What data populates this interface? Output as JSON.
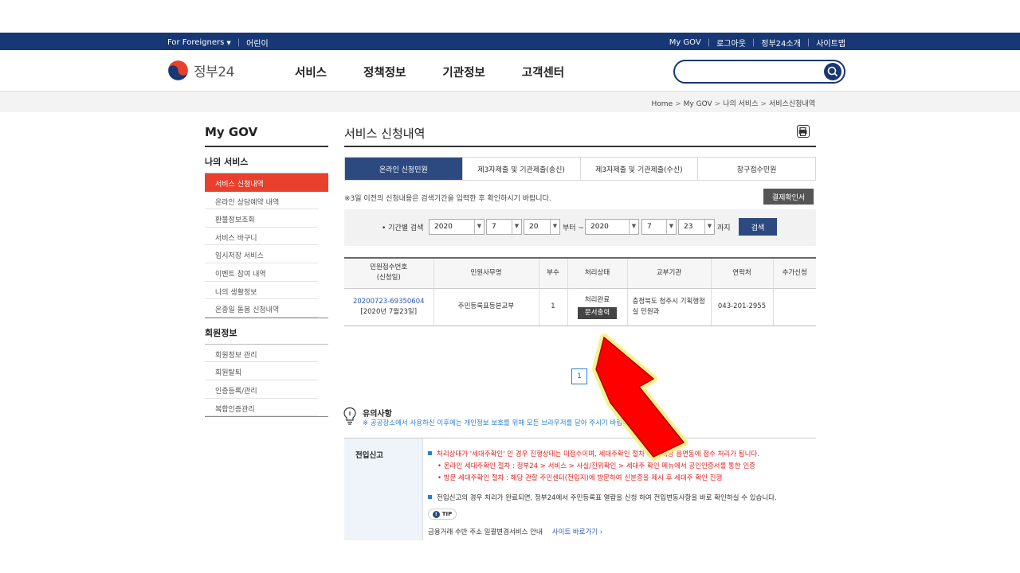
{
  "topbar": {
    "for_foreigners": "For Foreigners",
    "kids": "어린이",
    "my_gov": "My GOV",
    "logout": "로그아웃",
    "about": "정부24소개",
    "sitemap": "사이트맵"
  },
  "header": {
    "logo_text": "정부24",
    "nav": [
      "서비스",
      "정책정보",
      "기관정보",
      "고객센터"
    ],
    "search_value": ""
  },
  "breadcrumb": [
    "Home",
    "My GOV",
    "나의 서비스",
    "서비스신청내역"
  ],
  "sidebar": {
    "title": "My GOV",
    "group1": "나의 서비스",
    "items1": [
      "서비스 신청내역",
      "온라인 상담예약 내역",
      "환불정보조회",
      "서비스 바구니",
      "임시저장 서비스",
      "이벤트 참여 내역",
      "나의 생활정보",
      "온종일 돌봄 신청내역"
    ],
    "group2": "회원정보",
    "items2": [
      "회원정보 관리",
      "회원탈퇴",
      "인증등록/관리",
      "복합인증관리"
    ]
  },
  "main": {
    "title": "서비스 신청내역",
    "tabs": [
      "온라인 신청민원",
      "제3자제출 및 기관제출(송신)",
      "제3자제출 및 기관제출(수신)",
      "창구접수민원"
    ],
    "notice": "※3일 이전의 신청내용은 검색기간을 입력한 후 확인하시기 바랍니다.",
    "cert_button": "결제확인서",
    "period": {
      "label": "• 기간별 검색",
      "from_year": "2020",
      "from_month": "7",
      "from_day": "20",
      "from_suffix": "부터 ~",
      "to_year": "2020",
      "to_month": "7",
      "to_day": "23",
      "to_suffix": "까지",
      "search_button": "검색"
    },
    "table": {
      "headers": [
        "민원접수번호",
        "(신청일)",
        "민원사무명",
        "부수",
        "처리상태",
        "교부기관",
        "연락처",
        "추가신청"
      ],
      "row": {
        "receipt_no": "20200723-69350604",
        "date": "[2020년 7월23일]",
        "service": "주민등록표등본교부",
        "copies": "1",
        "status": "처리완료",
        "print_button": "문서출력",
        "agency_line1": "충청북도 청주시 기획행정",
        "agency_line2": "실 민원과",
        "phone": "043-201-2955",
        "extra": ""
      }
    },
    "pager": "1"
  },
  "caution": {
    "title": "유의사항",
    "subtitle": "※ 공공장소에서 사용하신 이후에는 개인정보 보호를 위해 모든 브라우저를 닫아 주시기 바랍니다.",
    "section_label": "전입신고",
    "line1": "처리상태가 '세대주확인' 인 경우 진행상태는 미접수이며, 세대주확인 절차 이후 해당 읍면동에 접수 처리가 됩니다.",
    "line2": "• 온라인 세대주확인 절차 : 정부24 > 서비스 > 사실/진위확인 > 세대주 확인 메뉴에서 공인인증서를 통한 인증",
    "line3": "• 방문 세대주확인 절차 : 해당 관할 주민센터(전입지)에 방문하여 신분증을 제시 후 세대주 확인 진행",
    "line4": "전입신고의 경우 처리가 완료되면, 정부24에서 주민등록표 열람을 신청 하여 전입변동사항을 바로 확인하실 수 있습니다.",
    "tip": "TIP",
    "line5": "금융거래 수반 주소 일괄변경서비스 안내",
    "site_link": "사이트 바로가기 ›"
  },
  "colors": {
    "navy": "#173775",
    "tab_active": "#2c4a80",
    "side_active": "#e8402c",
    "arrow_red": "#ff0000"
  }
}
